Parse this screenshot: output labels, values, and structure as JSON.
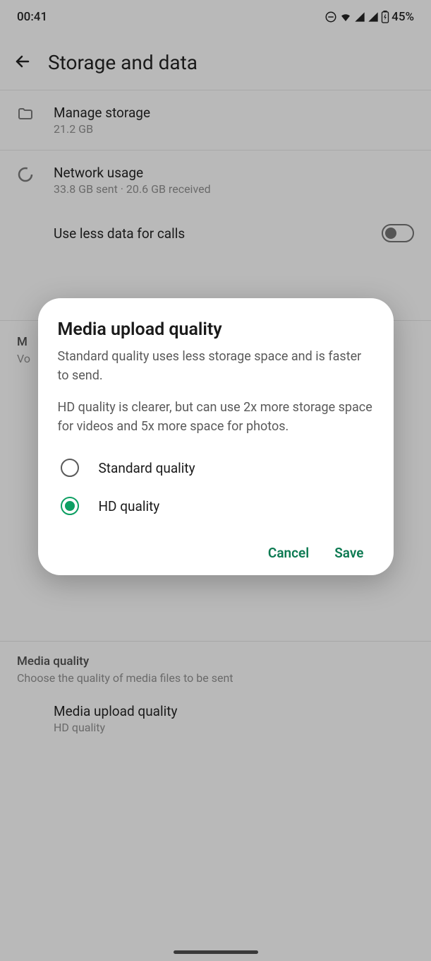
{
  "status": {
    "time": "00:41",
    "battery": "45%"
  },
  "header": {
    "title": "Storage and data"
  },
  "manage_storage": {
    "title": "Manage storage",
    "subtitle": "21.2 GB"
  },
  "network_usage": {
    "title": "Network usage",
    "subtitle": "33.8 GB sent · 20.6 GB received"
  },
  "use_less_data": {
    "label": "Use less data for calls"
  },
  "partial_visible": {
    "line1": "M",
    "line2": "Vo"
  },
  "media_quality_section": {
    "title": "Media quality",
    "subtitle": "Choose the quality of media files to be sent"
  },
  "media_upload_item": {
    "title": "Media upload quality",
    "subtitle": "HD quality"
  },
  "dialog": {
    "title": "Media upload quality",
    "desc1": "Standard quality uses less storage space and is faster to send.",
    "desc2": "HD quality is clearer, but can use 2x more storage space for videos and 5x more space for photos.",
    "option_standard": "Standard quality",
    "option_hd": "HD quality",
    "cancel": "Cancel",
    "save": "Save"
  }
}
